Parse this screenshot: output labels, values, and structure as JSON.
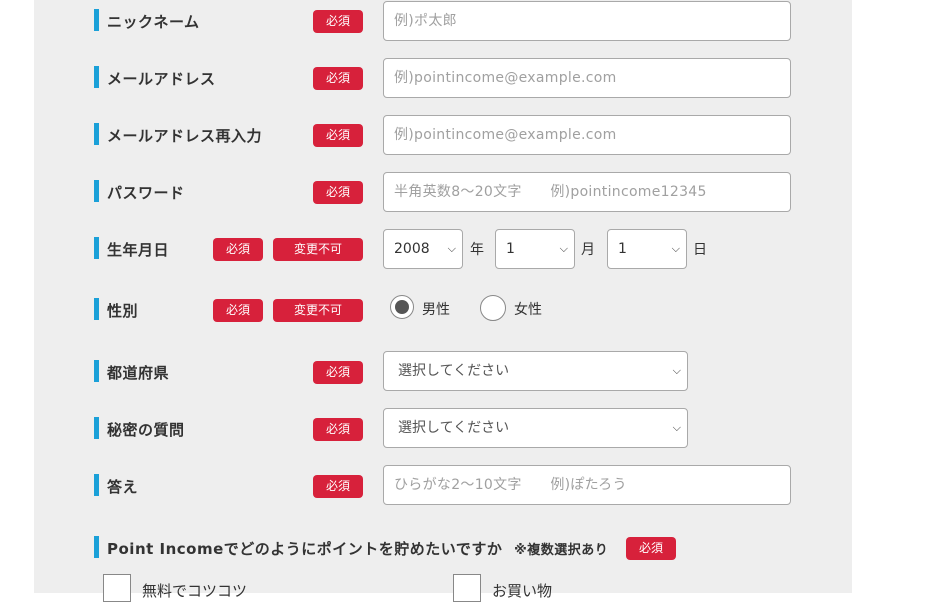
{
  "required_label": "必須",
  "fixed_label": "変更不可",
  "fields": {
    "nickname": {
      "label": "ニックネーム",
      "placeholder": "例)ポ太郎"
    },
    "email": {
      "label": "メールアドレス",
      "placeholder": "例)pointincome@example.com"
    },
    "email_confirm": {
      "label": "メールアドレス再入力",
      "placeholder": "例)pointincome@example.com"
    },
    "password": {
      "label": "パスワード",
      "placeholder": "半角英数8～20文字　　例)pointincome12345"
    },
    "birthday": {
      "label": "生年月日",
      "year_value": "2008",
      "year_unit": "年",
      "month_value": "1",
      "month_unit": "月",
      "day_value": "1",
      "day_unit": "日"
    },
    "gender": {
      "label": "性別",
      "options": [
        "男性",
        "女性"
      ],
      "selected": "男性"
    },
    "prefecture": {
      "label": "都道府県",
      "value": "選択してください"
    },
    "secret_question": {
      "label": "秘密の質問",
      "value": "選択してください"
    },
    "answer": {
      "label": "答え",
      "placeholder": "ひらがな2～10文字　　例)ぽたろう"
    }
  },
  "survey": {
    "label": "Point Incomeでどのようにポイントを貯めたいですか",
    "note": "※複数選択あり",
    "options": [
      "無料でコツコツ",
      "お買い物"
    ]
  }
}
